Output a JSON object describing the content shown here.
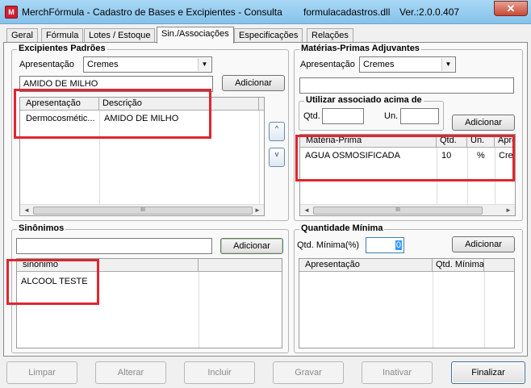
{
  "window": {
    "app_icon": "M",
    "title": "MerchFórmula - Cadastro de Bases e Excipientes - Consulta",
    "file": "formulacadastros.dll",
    "version": "Ver.:2.0.0.407",
    "close_glyph": "✕"
  },
  "tabs": [
    "Geral",
    "Fórmula",
    "Lotes / Estoque",
    "Sin./Associações",
    "Especificações",
    "Relações"
  ],
  "active_tab": "Sin./Associações",
  "excipientes": {
    "title": "Excipientes Padrões",
    "apresentacao_label": "Apresentação",
    "apresentacao_value": "Cremes",
    "item_input": "AMIDO DE MILHO",
    "add_label": "Adicionar",
    "columns": [
      "Apresentação",
      "Descrição"
    ],
    "rows": [
      [
        "Dermocosmétic...",
        "AMIDO DE MILHO"
      ]
    ],
    "up_glyph": "^",
    "down_glyph": "v"
  },
  "materias": {
    "title": "Matérias-Primas Adjuvantes",
    "apresentacao_label": "Apresentação",
    "apresentacao_value": "Cremes",
    "item_input": "",
    "utilizar_title": "Utilizar associado acima de",
    "qtd_label": "Qtd.",
    "qtd_value": "",
    "un_label": "Un.",
    "un_value": "",
    "add_label": "Adicionar",
    "columns": [
      "Matéria-Prima",
      "Qtd.",
      "Un.",
      "Apre"
    ],
    "rows": [
      [
        "AGUA OSMOSIFICADA",
        "10",
        "%",
        "Crem"
      ]
    ]
  },
  "sinonimos": {
    "title": "Sinônimos",
    "input_value": "",
    "add_label": "Adicionar",
    "columns": [
      "sinonimo"
    ],
    "rows": [
      "ALCOOL TESTE"
    ]
  },
  "quantidade": {
    "title": "Quantidade Mínima",
    "qtd_label": "Qtd. Mínima(%)",
    "qtd_value": "0",
    "add_label": "Adicionar",
    "columns": [
      "Apresentação",
      "Qtd. Mínima"
    ]
  },
  "scroll_glyphs": {
    "left": "◄",
    "right": "►",
    "thumb": "III"
  },
  "combo_arrow": "▼",
  "footer": {
    "limpar": "Limpar",
    "alterar": "Alterar",
    "incluir": "Incluir",
    "gravar": "Gravar",
    "inativar": "Inativar",
    "finalizar": "Finalizar"
  },
  "colors": {
    "highlight": "#e0252f",
    "title_bar": "#a9d8f5"
  }
}
